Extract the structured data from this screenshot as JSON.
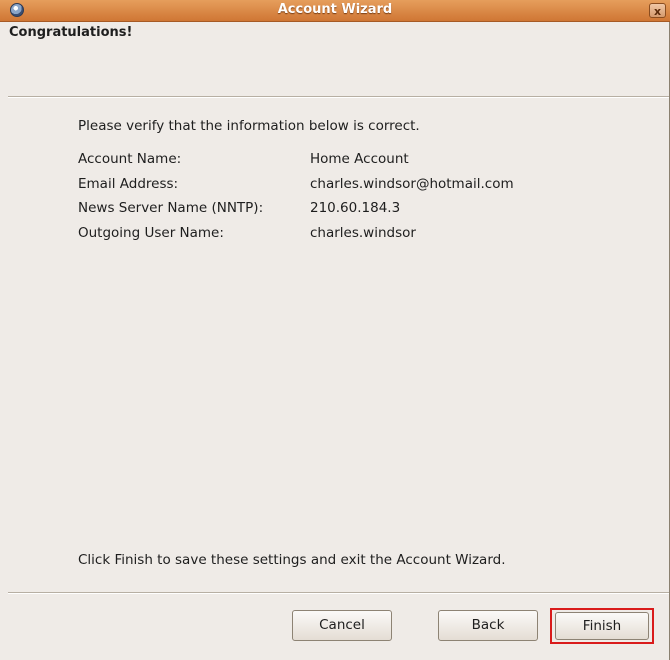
{
  "window": {
    "title": "Account Wizard",
    "close_glyph": "x"
  },
  "page": {
    "heading": "Congratulations!",
    "intro": "Please verify that the information below is correct.",
    "fields": [
      {
        "label": "Account Name:",
        "value": "Home Account"
      },
      {
        "label": "Email Address:",
        "value": "charles.windsor@hotmail.com"
      },
      {
        "label": "News Server Name (NNTP):",
        "value": "210.60.184.3"
      },
      {
        "label": "Outgoing User Name:",
        "value": "charles.windsor"
      }
    ],
    "footer_text": "Click Finish to save these settings and exit the Account Wizard."
  },
  "buttons": {
    "cancel": "Cancel",
    "back": "Back",
    "finish": "Finish"
  },
  "colors": {
    "titlebar": "#d8853f",
    "highlight": "#d91b1b",
    "background": "#efebe7"
  },
  "icons": {
    "app": "thunderbird-icon",
    "close": "close-icon"
  }
}
